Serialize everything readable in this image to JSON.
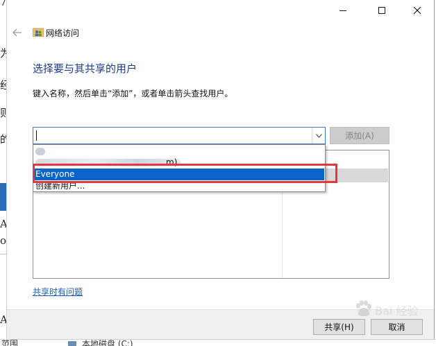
{
  "background_window": {
    "glyphs": [
      "7",
      "为",
      "经",
      "则",
      "的",
      "A",
      "o",
      "A"
    ],
    "bottom_left_text": "范围",
    "bottom_item_text": "本地磁盘 (C:)"
  },
  "dialog": {
    "window_controls": {
      "minimize": "minimize",
      "maximize": "maximize",
      "close": "close"
    },
    "back_icon": "back-arrow-icon",
    "title": "网络访问",
    "heading": "选择要与其共享的用户",
    "instruction": "键入名称，然后单击“添加”，或者单击箭头查找用户。",
    "name_input": {
      "value": "",
      "placeholder": ""
    },
    "add_button": "添加(A)",
    "dropdown_items": [
      {
        "label": "",
        "blurred": true
      },
      {
        "label": "m)",
        "blurred": true
      },
      {
        "label": "Everyone",
        "selected": true
      },
      {
        "label": "创建新用户..."
      }
    ],
    "help_link": "共享时有问题",
    "share_button": "共享(H)",
    "cancel_button": "取消"
  },
  "watermark": {
    "text": "Bai 经验",
    "icon": "baidu-paw-icon"
  },
  "colors": {
    "heading": "#1e3a8a",
    "selection": "#0a63c9",
    "highlight_box": "#e0393e",
    "link": "#1a5fb4"
  }
}
